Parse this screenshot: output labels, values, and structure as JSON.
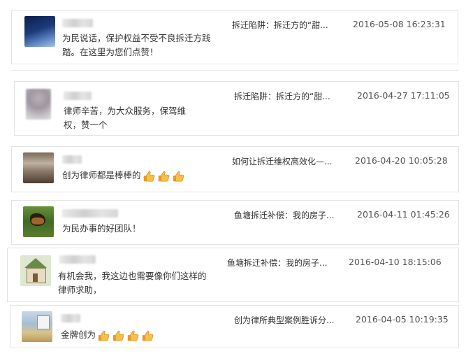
{
  "comments": [
    {
      "message": "为民说话，保护权益不受不良拆迁方践踏。在这里为您们点赞！",
      "article": "拆迁陷阱：拆迁方的“甜...",
      "time": "2016-05-08 16:23:31",
      "avatar": "night-sky-avatar"
    },
    {
      "message": "律师辛苦，为大众服务，保驾维权，赞一个",
      "article": "拆迁陷阱：拆迁方的“甜...",
      "time": "2016-04-27 17:11:05",
      "avatar": "blurred-person-avatar"
    },
    {
      "message": "创为律师都是棒棒的",
      "article": "如何让拆迁维权高效化—...",
      "time": "2016-04-20 10:05:28",
      "avatar": "room-avatar",
      "thumbs": 3
    },
    {
      "message": "为民办事的好团队！",
      "article": "鱼塘拆迁补偿：我的房子...",
      "time": "2016-04-11 01:45:26",
      "avatar": "dog-avatar"
    },
    {
      "message": "有机会我，我这边也需要像你们这样的律师求助，",
      "article": "鱼塘拆迁补偿：我的房子...",
      "time": "2016-04-10 18:15:06",
      "avatar": "house-money-avatar"
    },
    {
      "message": "金牌创为",
      "article": "创为律所典型案例胜诉分...",
      "time": "2016-04-05 10:19:35",
      "avatar": "office-avatar",
      "thumbs": 4
    }
  ],
  "colors": {
    "card_border": "#e3e3e3",
    "text": "#333333",
    "timestamp": "#555555",
    "thumb": "#f0b43a"
  }
}
